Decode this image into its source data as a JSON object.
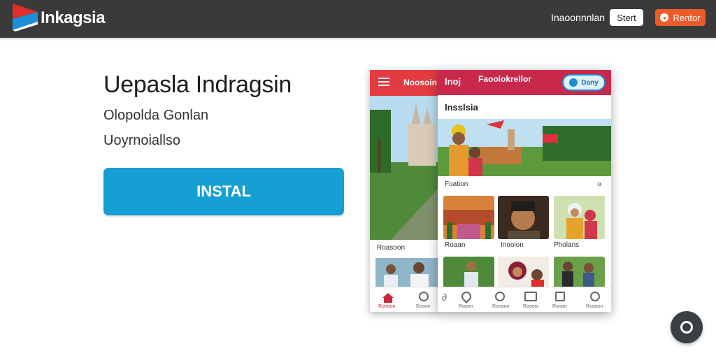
{
  "header": {
    "brand": "Inkagsia",
    "nav_link": "Inaoonnnlan",
    "start_button": "Stert",
    "orange_button": "Rentor"
  },
  "hero": {
    "title": "Uepasla Indragsin",
    "subtitle": "Olopolda Gonlan",
    "subtitle2": "Uoyrnoiallso",
    "install_button": "INSTAL"
  },
  "phone_back": {
    "header_title": "Noosoin",
    "section_label": "Roasoon",
    "nav": {
      "home_label": "Ronoon",
      "search_label": "Rooon"
    }
  },
  "phone_front": {
    "left_label": "Inoj",
    "header_title": "Faoolokrellor",
    "pill_label": "Dany",
    "heading": "Insslsia",
    "section_label": "Foation",
    "thumbnails": [
      {
        "label": "Roaan"
      },
      {
        "label": "Inooion"
      },
      {
        "label": "Pholans"
      }
    ],
    "nav_labels": [
      "Rooon",
      "Ronoon",
      "Roooio",
      "Rooon",
      "Roooon"
    ]
  },
  "colors": {
    "topbar": "#3a3a3a",
    "install": "#169fd2",
    "orange": "#ec5b2a",
    "app_red": "#c8284b"
  }
}
